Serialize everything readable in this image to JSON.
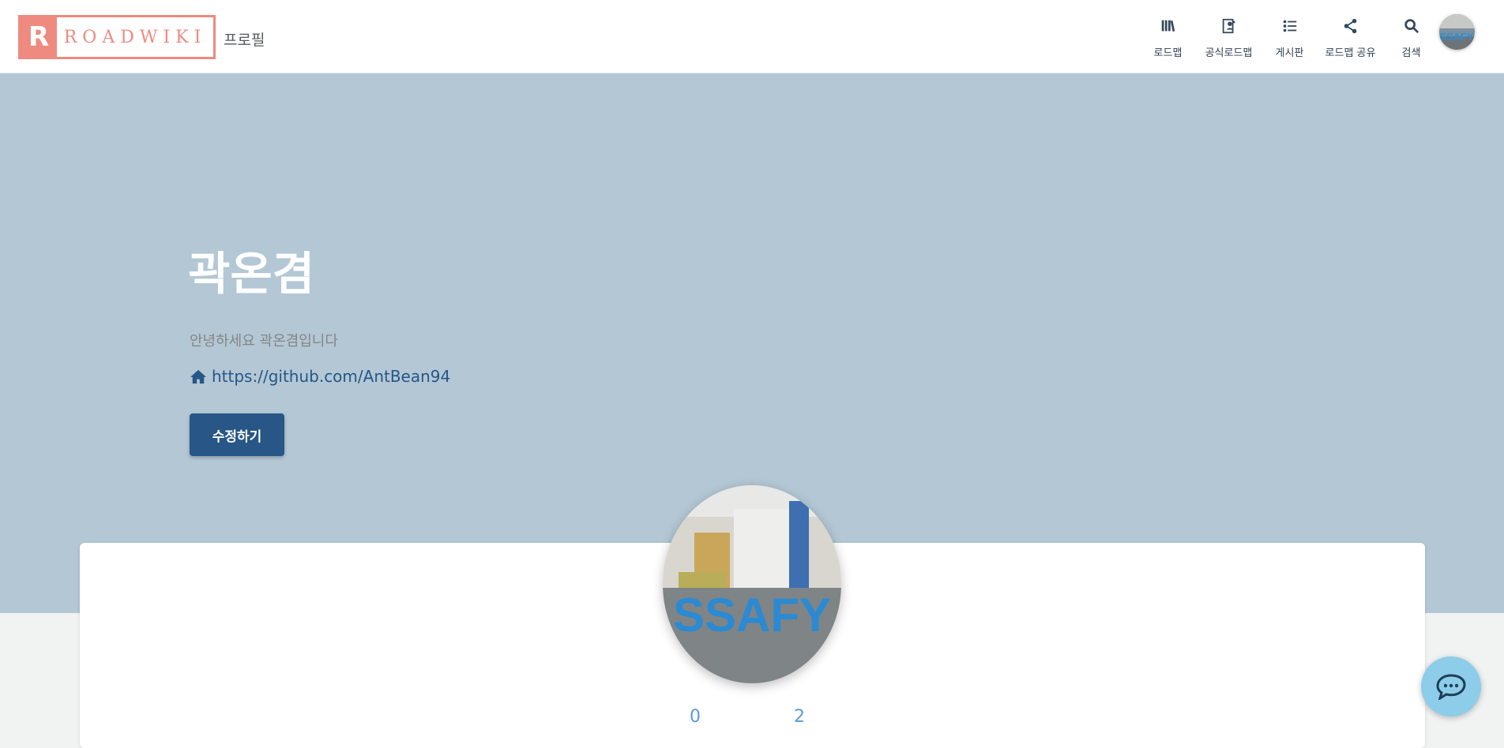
{
  "brand": {
    "mark": "R",
    "name": "ROADWIKI",
    "color": "#ef8a80"
  },
  "page_label": "프로필",
  "nav": [
    {
      "label": "로드맵",
      "icon": "books-icon"
    },
    {
      "label": "공식로드맵",
      "icon": "contact-book-icon"
    },
    {
      "label": "게시판",
      "icon": "list-icon"
    },
    {
      "label": "로드맵 공유",
      "icon": "share-icon"
    },
    {
      "label": "검색",
      "icon": "search-icon"
    }
  ],
  "profile": {
    "name": "곽온겸",
    "intro": "안녕하세요 곽온겸입니다",
    "link": "https://github.com/AntBean94",
    "edit_label": "수정하기",
    "avatar_text": "SSAFY"
  },
  "stats": {
    "first": "0",
    "second": "2"
  },
  "colors": {
    "hero_bg": "#b3c7d5",
    "primary": "#275687",
    "chat_button": "#8dcdea",
    "stat_text": "#5a9bd5"
  }
}
